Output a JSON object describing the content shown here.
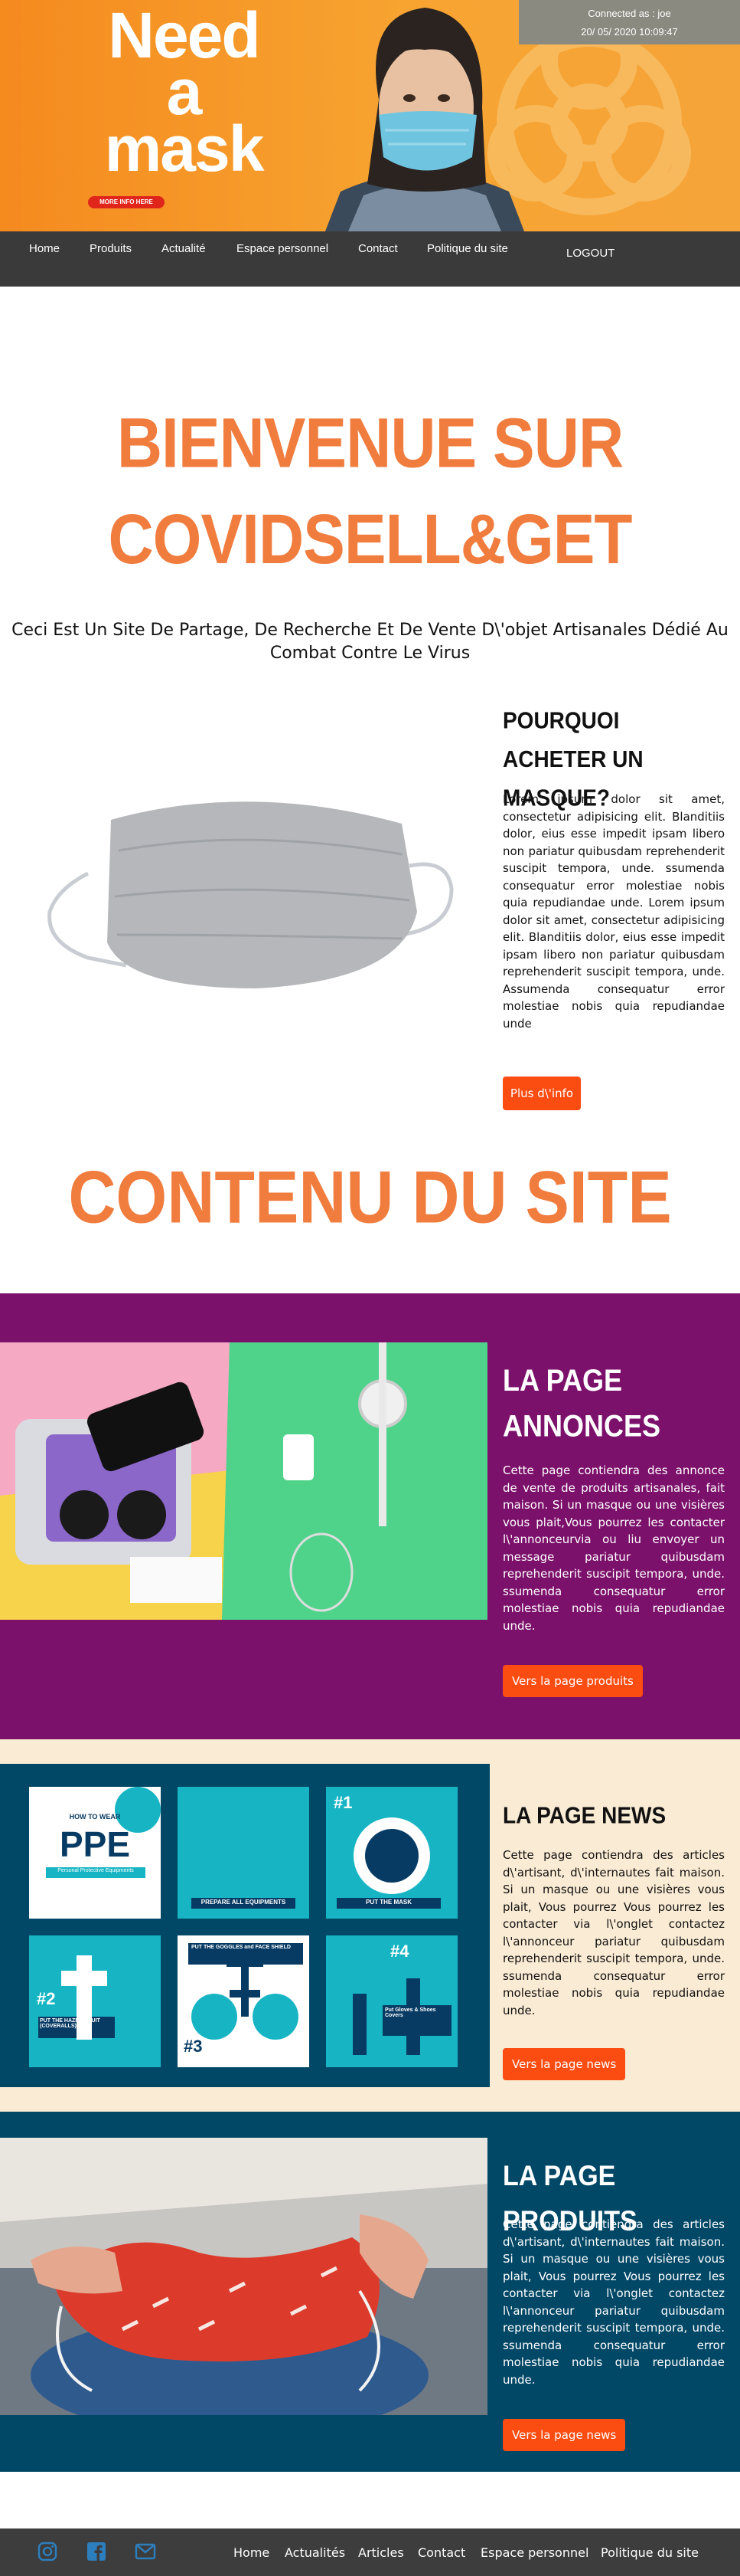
{
  "hero": {
    "logo_lines": [
      "Need",
      "a",
      "mask"
    ],
    "more_label": "MORE INFO HERE",
    "connected_as": "Connected as : joe",
    "datetime": "20/ 05/ 2020 10:09:47"
  },
  "nav": {
    "items": [
      "Home",
      "Produits",
      "Actualité",
      "Espace personnel",
      "Contact",
      "Politique du site"
    ],
    "logout": "LOGOUT"
  },
  "welcome": {
    "title_line1": "BIENVENUE SUR",
    "title_line2": "COVIDSELL&GET",
    "subtitle": "Ceci Est Un Site De Partage, De Recherche Et De Vente D\\'objet Artisanales Dédié Au Combat Contre Le Virus"
  },
  "why": {
    "title": "POURQUOI ACHETER UN MASQUE?",
    "text": "Lorem ipsum dolor sit amet, consectetur adipisicing elit. Blanditiis dolor, eius esse impedit ipsam libero non pariatur quibusdam reprehenderit suscipit tempora, unde. ssumenda consequatur error molestiae nobis quia repudiandae unde. Lorem ipsum dolor sit amet, consectetur adipisicing elit. Blanditiis dolor, eius esse impedit ipsam libero non pariatur quibusdam reprehenderit suscipit tempora, unde. Assumenda consequatur error molestiae nobis quia repudiandae unde",
    "button": "Plus d\\'info"
  },
  "contenu_title": "CONTENU DU SITE",
  "annonces": {
    "title_line1": "LA PAGE",
    "title_line2": "ANNONCES",
    "text": "Cette page contiendra des annonce de vente de produits artisanales, fait maison. Si un masque ou une visières vous plait,Vous pourrez les contacter l\\'annonceurvia ou liu envoyer un message pariatur quibusdam reprehenderit suscipit tempora, unde. ssumenda consequatur error molestiae nobis quia repudiandae unde.",
    "button": "Vers la page produits"
  },
  "news": {
    "title": "LA PAGE NEWS",
    "text": "Cette page contiendra des articles d\\'artisant, d\\'internautes fait maison. Si un masque ou une visières vous plait, Vous pourrez Vous pourrez les contacter via l\\'onglet contactez l\\'annonceur pariatur quibusdam reprehenderit suscipit tempora, unde. ssumenda consequatur error molestiae nobis quia repudiandae unde.",
    "button": "Vers la page news",
    "ppe": {
      "how_to": "HOW TO WEAR",
      "ppe": "PPE",
      "ppe_sub": "Personal Protective Equipments",
      "prepare": "PREPARE ALL EQUIPMENTS",
      "put_mask": "PUT THE MASK",
      "suit": "PUT THE HAZMAT SUIT (COVERALLS)",
      "goggles": "PUT THE GOGGLES and FACE SHIELD",
      "gloves": "Put Gloves & Shoes Covers",
      "n1": "#1",
      "n2": "#2",
      "n3": "#3",
      "n4": "#4"
    }
  },
  "produits": {
    "title": "LA PAGE PRODUITS",
    "text": "Cette page contiendra des articles d\\'artisant, d\\'internautes fait maison. Si un masque ou une visières vous plait, Vous pourrez Vous pourrez les contacter via l\\'onglet contactez l\\'annonceur pariatur quibusdam reprehenderit suscipit tempora, unde. ssumenda consequatur error molestiae nobis quia repudiandae unde.",
    "button": "Vers la page news"
  },
  "footer": {
    "links": [
      "Home",
      "Actualités",
      "Articles",
      "Contact",
      "Espace personnel",
      "Politique du site"
    ],
    "icons": [
      "instagram-icon",
      "facebook-icon",
      "mail-icon"
    ]
  },
  "colors": {
    "accent": "#f07c3e",
    "button": "#fb4c12",
    "purple": "#7c116b",
    "navy": "#014766",
    "cream": "#faebd4",
    "nav": "#3a3a3a"
  }
}
